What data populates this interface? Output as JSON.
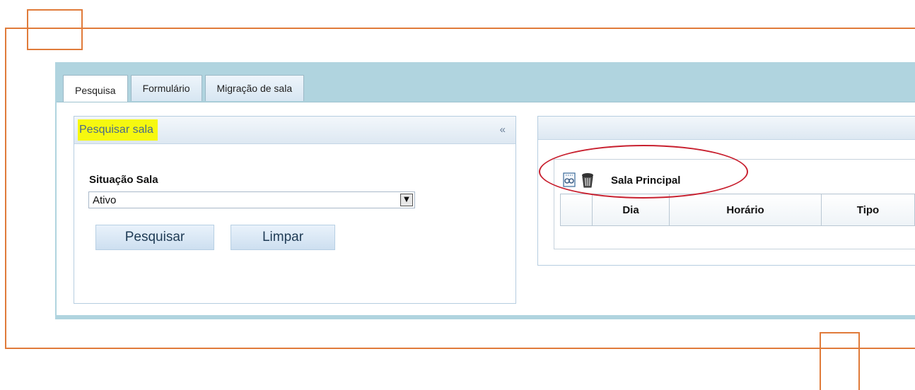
{
  "tabs": [
    {
      "label": "Pesquisa",
      "active": true
    },
    {
      "label": "Formulário",
      "active": false
    },
    {
      "label": "Migração de sala",
      "active": false
    }
  ],
  "search_panel": {
    "title": "Pesquisar sala",
    "collapse_glyph": "«",
    "field_label": "Situação Sala",
    "select_value": "Ativo",
    "buttons": {
      "search": "Pesquisar",
      "clear": "Limpar"
    }
  },
  "room_panel": {
    "room_name": "Sala Principal",
    "icons": [
      "edit-view-icon",
      "trash-icon"
    ],
    "columns": [
      "",
      "Dia",
      "Horário",
      "Tipo"
    ]
  },
  "colors": {
    "frame": "#e07b3a",
    "highlight": "#f6f80f",
    "annotation_ellipse": "#c8202f",
    "app_bg": "#b0d4df"
  }
}
